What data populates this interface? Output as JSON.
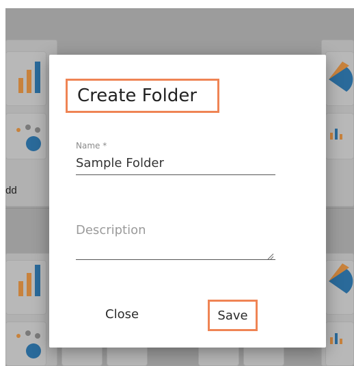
{
  "dialog": {
    "title": "Create Folder",
    "name_label": "Name *",
    "name_value": "Sample Folder",
    "description_placeholder": "Description",
    "close_label": "Close",
    "save_label": "Save",
    "highlight_color": "#ef8454"
  },
  "background": {
    "partial_text": "dd"
  },
  "icons": [
    "bar-chart-icon",
    "pie-chart-icon",
    "scatter-chart-icon",
    "mini-bar-icon",
    "resize-grip-icon"
  ]
}
